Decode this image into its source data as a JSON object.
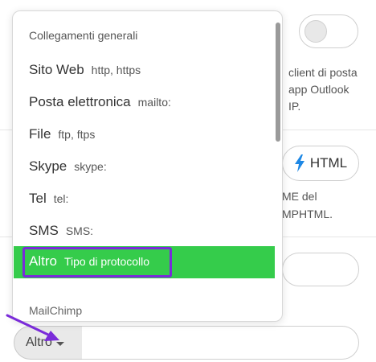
{
  "background": {
    "email_desc_lines": [
      "client di posta",
      "app Outlook",
      "IP."
    ],
    "format_button_label": "HTML",
    "format_desc_lines": [
      "ME del",
      "MPHTML."
    ]
  },
  "menu": {
    "header": "Collegamenti generali",
    "items": [
      {
        "name": "Sito Web",
        "proto": "http, https"
      },
      {
        "name": "Posta elettronica",
        "proto": "mailto:"
      },
      {
        "name": "File",
        "proto": "ftp, ftps"
      },
      {
        "name": "Skype",
        "proto": "skype:"
      },
      {
        "name": "Tel",
        "proto": "tel:"
      },
      {
        "name": "SMS",
        "proto": "SMS:"
      },
      {
        "name": "Altro",
        "proto": "Tipo di protocollo"
      }
    ],
    "selected_index": 6,
    "footer_section": "MailChimp"
  },
  "protocol_select": {
    "value": "Altro"
  },
  "colors": {
    "selected_bg": "#35cc4b",
    "highlight_border": "#7a2bd9",
    "arrow": "#7a2bd9",
    "lightning": "#1e88e5"
  }
}
